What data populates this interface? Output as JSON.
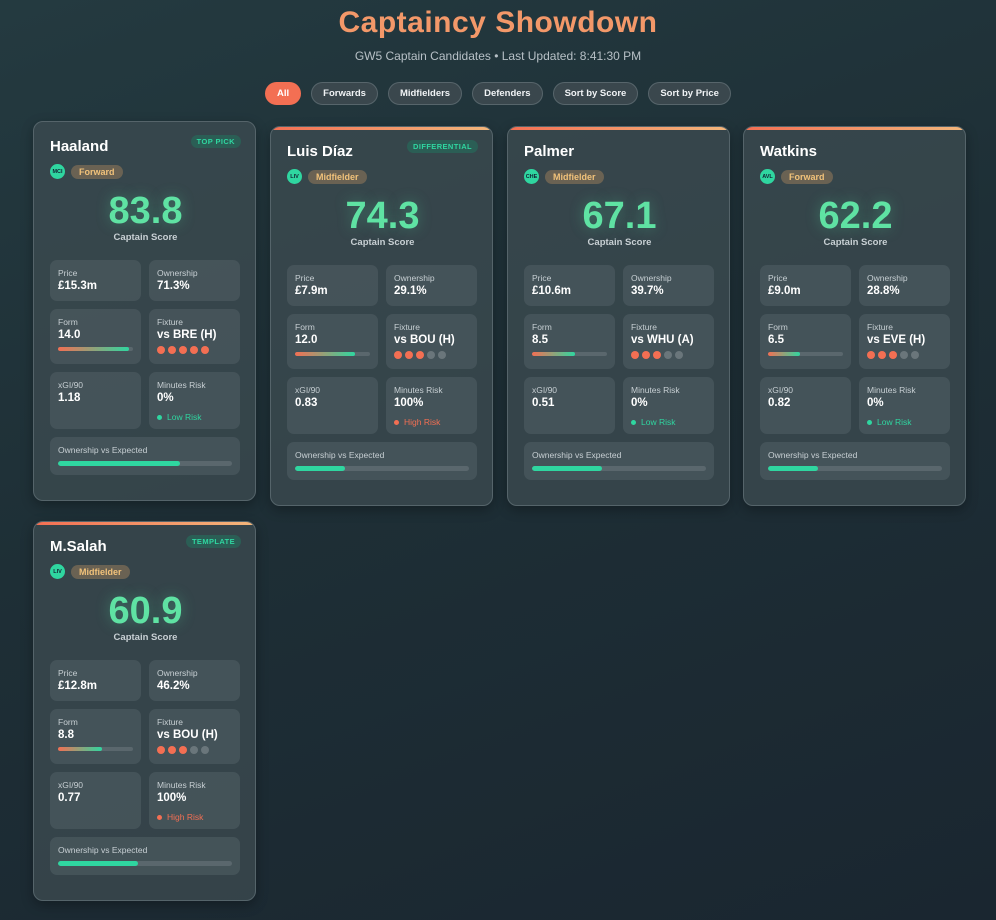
{
  "header": {
    "title": "Captaincy Showdown",
    "subtitle": "GW5 Captain Candidates • Last Updated: 8:41:30 PM"
  },
  "filters": [
    {
      "label": "All",
      "active": true
    },
    {
      "label": "Forwards",
      "active": false
    },
    {
      "label": "Midfielders",
      "active": false
    },
    {
      "label": "Defenders",
      "active": false
    },
    {
      "label": "Sort by Score",
      "active": false
    },
    {
      "label": "Sort by Price",
      "active": false
    }
  ],
  "labels": {
    "captain_score": "Captain Score",
    "price": "Price",
    "ownership": "Ownership",
    "form": "Form",
    "fixture": "Fixture",
    "xgi": "xGI/90",
    "minutes_risk": "Minutes Risk",
    "own_vs_expected": "Ownership vs Expected"
  },
  "colors": {
    "accent": "#f36f53",
    "score_green": "#5fe2a3",
    "teal": "#2fd6a0"
  },
  "players": [
    {
      "name": "Haaland",
      "badge": "TOP PICK",
      "team": "MCI",
      "position": "Forward",
      "score": "83.8",
      "price": "£15.3m",
      "ownership": "71.3%",
      "form": "14.0",
      "form_pct": 95,
      "fixture": "vs BRE (H)",
      "difficulty_dots": 5,
      "xgi": "1.18",
      "minutes_risk": "0%",
      "risk_text": "Low Risk",
      "risk_level": "low",
      "own_expected_pct": 70
    },
    {
      "name": "Luis Díaz",
      "badge": "DIFFERENTIAL",
      "team": "LIV",
      "position": "Midfielder",
      "score": "74.3",
      "price": "£7.9m",
      "ownership": "29.1%",
      "form": "12.0",
      "form_pct": 80,
      "fixture": "vs BOU (H)",
      "difficulty_dots": 3,
      "xgi": "0.83",
      "minutes_risk": "100%",
      "risk_text": "High Risk",
      "risk_level": "high",
      "own_expected_pct": 29
    },
    {
      "name": "Palmer",
      "badge": "",
      "team": "CHE",
      "position": "Midfielder",
      "score": "67.1",
      "price": "£10.6m",
      "ownership": "39.7%",
      "form": "8.5",
      "form_pct": 57,
      "fixture": "vs WHU (A)",
      "difficulty_dots": 3,
      "xgi": "0.51",
      "minutes_risk": "0%",
      "risk_text": "Low Risk",
      "risk_level": "low",
      "own_expected_pct": 40
    },
    {
      "name": "Watkins",
      "badge": "",
      "team": "AVL",
      "position": "Forward",
      "score": "62.2",
      "price": "£9.0m",
      "ownership": "28.8%",
      "form": "6.5",
      "form_pct": 43,
      "fixture": "vs EVE (H)",
      "difficulty_dots": 3,
      "xgi": "0.82",
      "minutes_risk": "0%",
      "risk_text": "Low Risk",
      "risk_level": "low",
      "own_expected_pct": 29
    },
    {
      "name": "M.Salah",
      "badge": "TEMPLATE",
      "team": "LIV",
      "position": "Midfielder",
      "score": "60.9",
      "price": "£12.8m",
      "ownership": "46.2%",
      "form": "8.8",
      "form_pct": 59,
      "fixture": "vs BOU (H)",
      "difficulty_dots": 3,
      "xgi": "0.77",
      "minutes_risk": "100%",
      "risk_text": "High Risk",
      "risk_level": "high",
      "own_expected_pct": 46
    }
  ]
}
